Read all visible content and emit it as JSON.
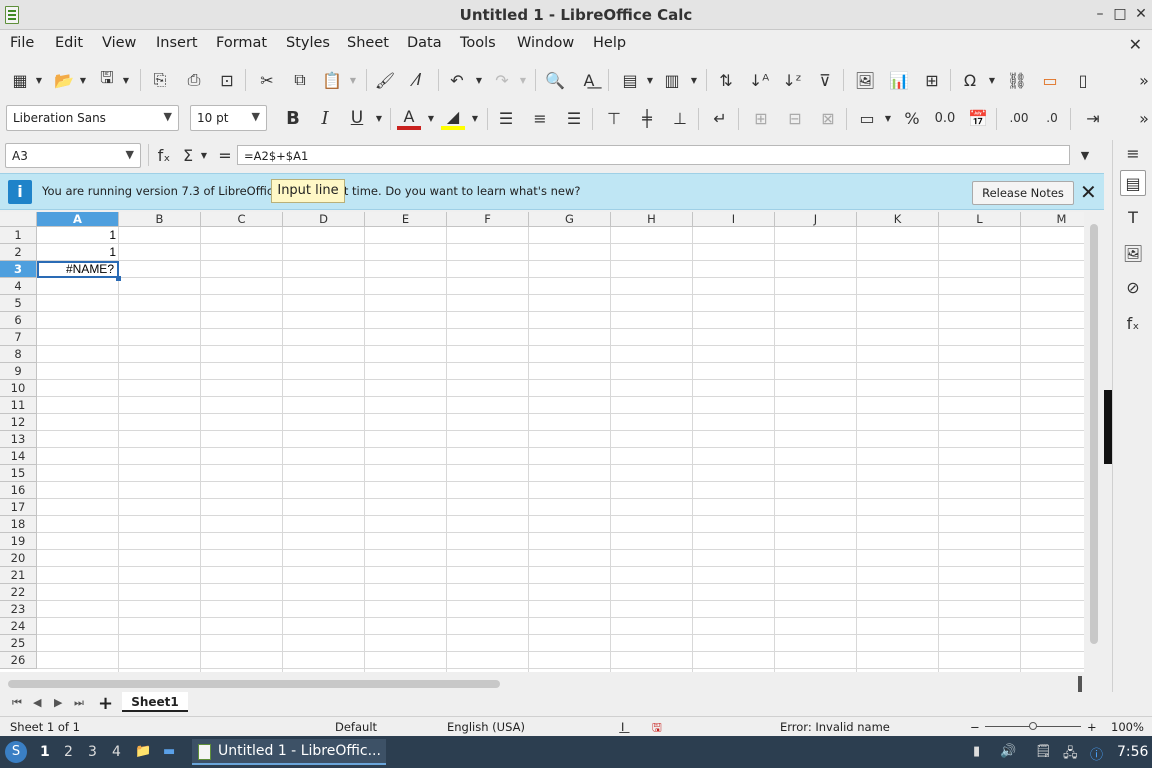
{
  "window": {
    "title": "Untitled 1 - LibreOffice Calc"
  },
  "menu": [
    "File",
    "Edit",
    "View",
    "Insert",
    "Format",
    "Styles",
    "Sheet",
    "Data",
    "Tools",
    "Window",
    "Help"
  ],
  "formatting": {
    "font_name": "Liberation Sans",
    "font_size": "10 pt"
  },
  "formula_bar": {
    "name_box": "A3",
    "formula": "=A2$+$A1",
    "fx": "fₓ",
    "sigma": "Σ",
    "equals": "="
  },
  "infobar": {
    "message": "You are running version 7.3 of LibreOffice for the first time. Do you want to learn what's new?",
    "button": "Release Notes"
  },
  "tooltip": "Input line",
  "grid": {
    "columns": [
      "A",
      "B",
      "C",
      "D",
      "E",
      "F",
      "G",
      "H",
      "I",
      "J",
      "K",
      "L",
      "M"
    ],
    "rows": [
      "1",
      "2",
      "3",
      "4",
      "5",
      "6",
      "7",
      "8",
      "9",
      "10",
      "11",
      "12",
      "13",
      "14",
      "15",
      "16",
      "17",
      "18",
      "19",
      "20",
      "21",
      "22",
      "23",
      "24",
      "25",
      "26"
    ],
    "active_column": "A",
    "active_row": "3",
    "cells": {
      "A1": "1",
      "A2": "1",
      "A3": "#NAME?"
    }
  },
  "sheet_tabs": {
    "active": "Sheet1"
  },
  "status_bar": {
    "sheet": "Sheet 1 of 1",
    "style": "Default",
    "language": "English (USA)",
    "message": "Error: Invalid name",
    "zoom_minus": "−",
    "zoom_plus": "+",
    "zoom": "100%"
  },
  "taskbar": {
    "workspaces": [
      "1",
      "2",
      "3",
      "4"
    ],
    "active_workspace": "1",
    "app": "Untitled 1 - LibreOffic...",
    "clock": "7:56"
  }
}
